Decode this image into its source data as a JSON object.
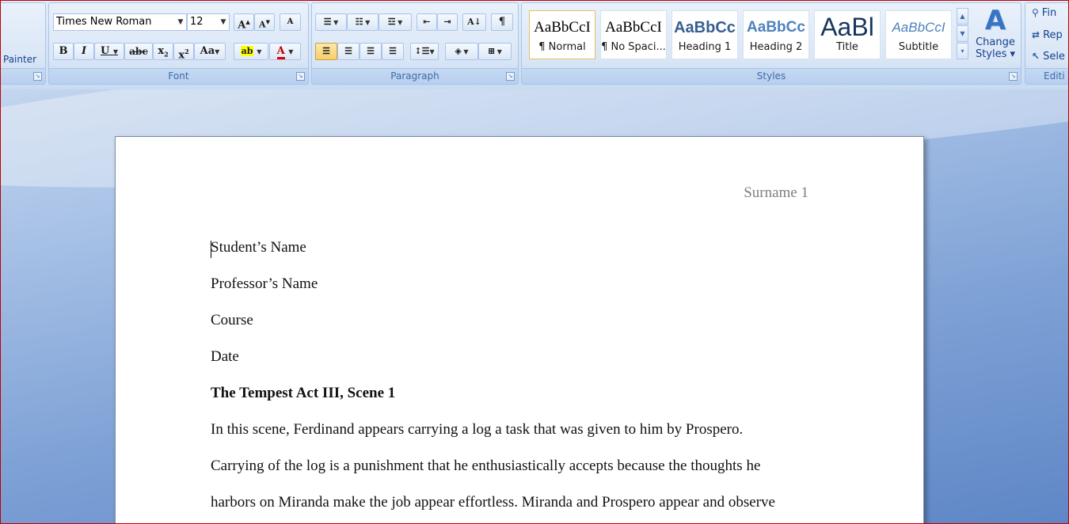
{
  "ribbon": {
    "clipboard": {
      "painter_label": "Painter"
    },
    "font": {
      "group_label": "Font",
      "font_name": "Times New Roman",
      "font_size": "12",
      "grow": "A",
      "shrink": "A",
      "clear": "A",
      "bold": "B",
      "italic": "I",
      "underline": "U",
      "strike": "abc",
      "subscript": "x",
      "superscript": "x",
      "change_case": "Aa",
      "highlight": "ab",
      "font_color": "A"
    },
    "paragraph": {
      "group_label": "Paragraph",
      "pilcrow": "¶",
      "sort": "A↓"
    },
    "styles": {
      "group_label": "Styles",
      "tiles": [
        {
          "sample": "AaBbCcI",
          "name": "¶ Normal"
        },
        {
          "sample": "AaBbCcI",
          "name": "¶ No Spaci..."
        },
        {
          "sample": "AaBbCc",
          "name": "Heading 1"
        },
        {
          "sample": "AaBbCc",
          "name": "Heading 2"
        },
        {
          "sample": "AaBl",
          "name": "Title"
        },
        {
          "sample": "AaBbCcI",
          "name": "Subtitle"
        }
      ],
      "change_styles_icon": "A",
      "change_styles_line1": "Change",
      "change_styles_line2": "Styles ▾"
    },
    "editing": {
      "group_label": "Editi",
      "find": "Fin",
      "replace": "Rep",
      "select": "Sele"
    }
  },
  "document": {
    "header": "Surname 1",
    "lines": [
      "Student’s Name",
      "Professor’s Name",
      "Course",
      "Date",
      "The Tempest Act III, Scene 1",
      "In this scene, Ferdinand appears carrying a log a task that was given to him by Prospero.",
      "Carrying of the log is a punishment that he enthusiastically accepts because the thoughts he",
      "harbors on Miranda make the job appear effortless. Miranda and Prospero appear and observe"
    ]
  }
}
